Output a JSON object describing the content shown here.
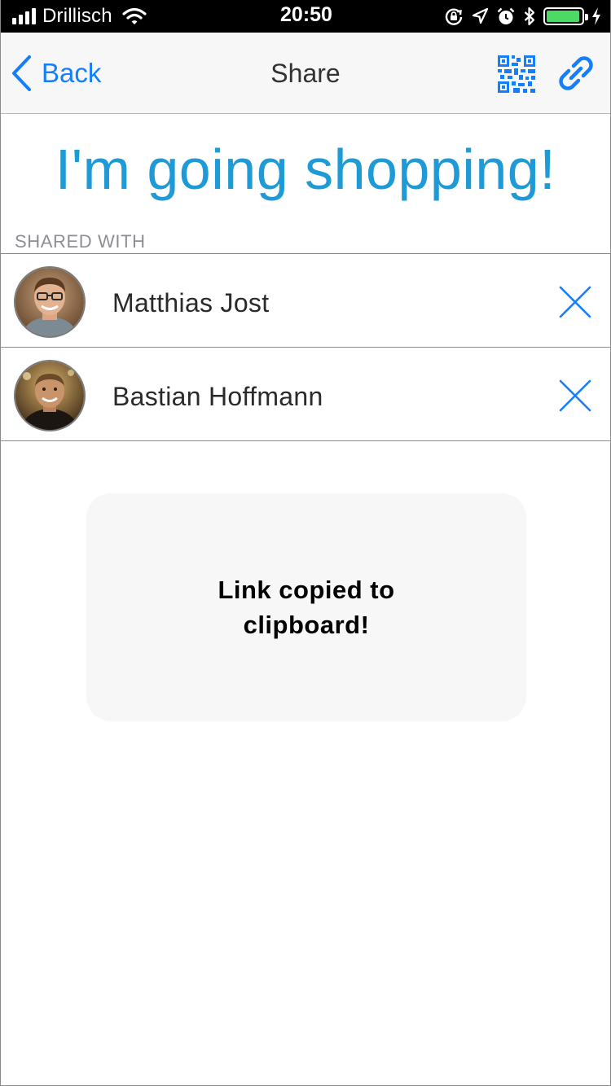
{
  "status_bar": {
    "carrier": "Drillisch",
    "time": "20:50",
    "battery_level": 0.95,
    "battery_color": "#4cd964",
    "icons": [
      "signal-icon",
      "wifi-icon",
      "rotation-lock-icon",
      "location-icon",
      "alarm-icon",
      "bluetooth-icon",
      "battery-icon",
      "charging-icon"
    ]
  },
  "nav": {
    "back_label": "Back",
    "title": "Share",
    "qr_icon": "qr-code-icon",
    "link_icon": "link-icon",
    "accent_color": "#157efb"
  },
  "list": {
    "title": "I'm going shopping!",
    "title_color": "#1e9ad6"
  },
  "shared_with": {
    "header": "SHARED WITH",
    "people": [
      {
        "name": "Matthias Jost"
      },
      {
        "name": "Bastian Hoffmann"
      }
    ]
  },
  "toast": {
    "message": "Link copied to clipboard!"
  }
}
